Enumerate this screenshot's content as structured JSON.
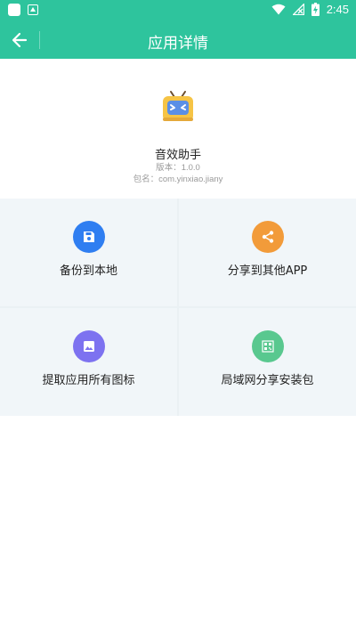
{
  "status_bar": {
    "time": "2:45",
    "icons": [
      "app-notification-icon",
      "store-notification-icon",
      "wifi-icon",
      "no-signal-icon",
      "battery-charging-icon"
    ]
  },
  "app_bar": {
    "title": "应用详情",
    "back_icon": "arrow-left-icon",
    "color": "#2ec49d"
  },
  "app_info": {
    "name": "音效助手",
    "version_label": "版本：",
    "version": "1.0.0",
    "package_label": "包名：",
    "package": "com.yinxiao.jiany",
    "logo_icon": "tv-robot-logo-icon"
  },
  "actions": [
    {
      "label": "备份到本地",
      "icon": "save-icon",
      "color": "#2f7ef1"
    },
    {
      "label": "分享到其他APP",
      "icon": "share-icon",
      "color": "#f29b3a"
    },
    {
      "label": "提取应用所有图标",
      "icon": "image-icon",
      "color": "#7d72f0"
    },
    {
      "label": "局域网分享安装包",
      "icon": "qr-code-icon",
      "color": "#59c88f"
    }
  ]
}
